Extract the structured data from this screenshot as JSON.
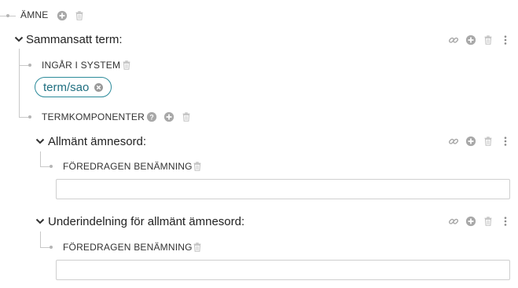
{
  "root": {
    "label": "ÄMNE"
  },
  "compound": {
    "title": "Sammansatt term:",
    "system_field": {
      "label": "INGÅR I SYSTEM",
      "chip": "term/sao"
    },
    "components_field": {
      "label": "TERMKOMPONENTER"
    },
    "components": [
      {
        "title": "Allmänt ämnesord:",
        "field_label": "FÖREDRAGEN BENÄMNING",
        "value": ""
      },
      {
        "title": "Underindelning för allmänt ämnesord:",
        "field_label": "FÖREDRAGEN BENÄMNING",
        "value": ""
      }
    ]
  },
  "colors": {
    "chip_border": "#2b8a9a",
    "chip_text": "#1f6f80",
    "icon_gray": "#a8a8a8",
    "tree_line": "#c8c8c8"
  },
  "icons": [
    "plus-circle-icon",
    "trash-icon",
    "link-icon",
    "more-vertical-icon",
    "help-icon",
    "chevron-down-icon",
    "remove-chip-icon"
  ]
}
